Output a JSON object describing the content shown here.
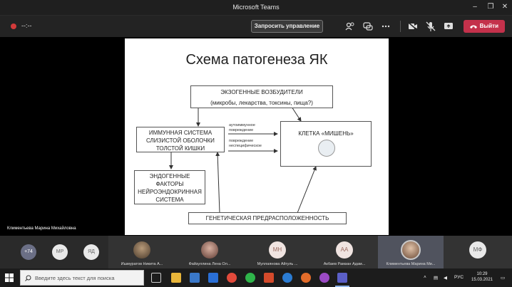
{
  "window": {
    "title": "Microsoft Teams"
  },
  "toolbar": {
    "timer": "--:--",
    "request_control_label": "Запросить управление",
    "leave_label": "Выйти",
    "colors": {
      "leave": "#c4314b",
      "record": "#d23a3a"
    }
  },
  "slide": {
    "title": "Схема патогенеза ЯК",
    "exo_line1": "ЭКЗОГЕННЫЕ ВОЗБУДИТЕЛИ",
    "exo_line2": "(микробы, лекарства, токсины, пища?)",
    "immune_line1": "ИММУННАЯ СИСТЕМА",
    "immune_line2": "СЛИЗИСТОЙ ОБОЛОЧКИ",
    "immune_line3": "ТОЛСТОЙ КИШКИ",
    "target": "КЛЕТКА «МИШЕНЬ»",
    "autoimmune_line1": "аутоиммунное",
    "autoimmune_line2": "повреждение",
    "nonspecific_line1": "повреждение",
    "nonspecific_line2": "неспецифическое",
    "endo_line1": "ЭНДОГЕННЫЕ",
    "endo_line2": "ФАКТОРЫ",
    "endo_line3": "НЕЙРОЭНДОКРИННАЯ",
    "endo_line4": "СИСТЕМА",
    "genetic": "ГЕНЕТИЧЕСКАЯ ПРЕДРАСПОЛОЖЕННОСТЬ"
  },
  "stage": {
    "speaker": "Климентьева Марина Михайловна"
  },
  "participants": {
    "overflow": "+74",
    "small": [
      "МР",
      "ЯД"
    ],
    "tiles": [
      {
        "name": "Ишмуратов Никита А...",
        "initials": ""
      },
      {
        "name": "Файзуллина Лена Ол...",
        "initials": ""
      },
      {
        "name": "Муллаянова Айгуль ...",
        "initials": "МН"
      },
      {
        "name": "Акбаев Рамзан Адам...",
        "initials": "АА"
      },
      {
        "name": "Климентьева Марина Ми...",
        "initials": ""
      },
      {
        "name": "",
        "initials": "МФ"
      }
    ]
  },
  "taskbar": {
    "search_placeholder": "Введите здесь текст для поиска",
    "lang": "РУС",
    "time": "10:29",
    "date": "15.03.2021"
  }
}
